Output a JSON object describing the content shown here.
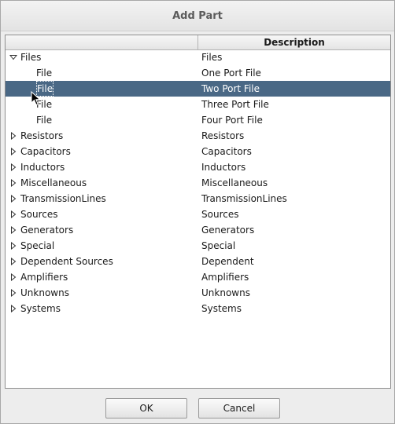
{
  "window": {
    "title": "Add Part"
  },
  "table": {
    "columns": [
      "",
      "Description"
    ],
    "rows": [
      {
        "name": "Files",
        "description": "Files",
        "level": 0,
        "expanded": true,
        "selected": false
      },
      {
        "name": "File",
        "description": "One Port File",
        "level": 1,
        "expanded": false,
        "selected": false
      },
      {
        "name": "File",
        "description": "Two Port File",
        "level": 1,
        "expanded": false,
        "selected": true
      },
      {
        "name": "File",
        "description": "Three Port File",
        "level": 1,
        "expanded": false,
        "selected": false
      },
      {
        "name": "File",
        "description": "Four Port File",
        "level": 1,
        "expanded": false,
        "selected": false
      },
      {
        "name": "Resistors",
        "description": "Resistors",
        "level": 0,
        "expanded": false,
        "selected": false
      },
      {
        "name": "Capacitors",
        "description": "Capacitors",
        "level": 0,
        "expanded": false,
        "selected": false
      },
      {
        "name": "Inductors",
        "description": "Inductors",
        "level": 0,
        "expanded": false,
        "selected": false
      },
      {
        "name": "Miscellaneous",
        "description": "Miscellaneous",
        "level": 0,
        "expanded": false,
        "selected": false
      },
      {
        "name": "TransmissionLines",
        "description": "TransmissionLines",
        "level": 0,
        "expanded": false,
        "selected": false
      },
      {
        "name": "Sources",
        "description": "Sources",
        "level": 0,
        "expanded": false,
        "selected": false
      },
      {
        "name": "Generators",
        "description": "Generators",
        "level": 0,
        "expanded": false,
        "selected": false
      },
      {
        "name": "Special",
        "description": "Special",
        "level": 0,
        "expanded": false,
        "selected": false
      },
      {
        "name": "Dependent Sources",
        "description": "Dependent",
        "level": 0,
        "expanded": false,
        "selected": false
      },
      {
        "name": "Amplifiers",
        "description": "Amplifiers",
        "level": 0,
        "expanded": false,
        "selected": false
      },
      {
        "name": "Unknowns",
        "description": "Unknowns",
        "level": 0,
        "expanded": false,
        "selected": false
      },
      {
        "name": "Systems",
        "description": "Systems",
        "level": 0,
        "expanded": false,
        "selected": false
      }
    ]
  },
  "buttons": {
    "ok_label": "OK",
    "cancel_label": "Cancel"
  },
  "colors": {
    "selection": "#4a6885",
    "selection_text": "#ffffff"
  },
  "icons": {
    "collapsed": "triangle-right-icon",
    "expanded": "triangle-down-icon",
    "cursor": "mouse-pointer-icon"
  }
}
